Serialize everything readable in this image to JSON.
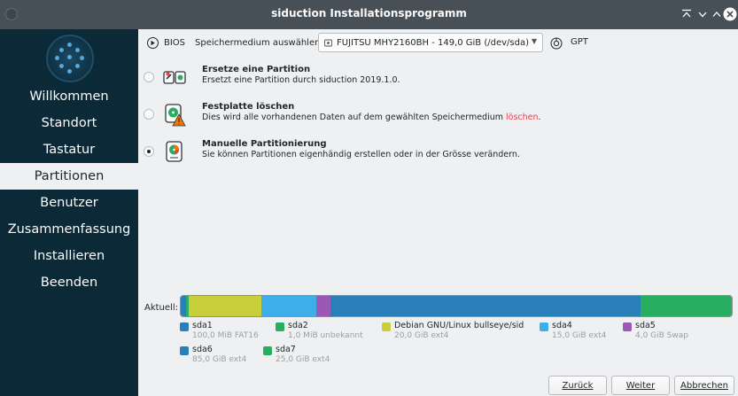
{
  "window": {
    "title": "siduction Installationsprogramm"
  },
  "sidebar": {
    "items": [
      {
        "label": "Willkommen",
        "active": false
      },
      {
        "label": "Standort",
        "active": false
      },
      {
        "label": "Tastatur",
        "active": false
      },
      {
        "label": "Partitionen",
        "active": true
      },
      {
        "label": "Benutzer",
        "active": false
      },
      {
        "label": "Zusammenfassung",
        "active": false
      },
      {
        "label": "Installieren",
        "active": false
      },
      {
        "label": "Beenden",
        "active": false
      }
    ]
  },
  "header": {
    "bios_label": "BIOS",
    "storage_label": "Speichermedium auswählen",
    "storage_selected": "FUJITSU MHY2160BH - 149,0 GiB (/dev/sda)",
    "table_type": "GPT"
  },
  "options": [
    {
      "title": "Ersetze eine Partition",
      "desc": "Ersetzt eine Partition durch siduction 2019.1.0.",
      "desc_red": "",
      "desc_end": "",
      "checked": false,
      "icon": "replace-partition-icon"
    },
    {
      "title": "Festplatte löschen",
      "desc": "Dies wird alle vorhandenen Daten auf dem gewählten Speichermedium ",
      "desc_red": "löschen",
      "desc_end": ".",
      "checked": false,
      "icon": "erase-disk-icon"
    },
    {
      "title": "Manuelle Partitionierung",
      "desc": "Sie können Partitionen eigenhändig erstellen oder in der Grösse verändern.",
      "desc_red": "",
      "desc_end": "",
      "checked": true,
      "icon": "manual-partition-icon"
    }
  ],
  "current": {
    "label": "Aktuell:",
    "partitions": [
      {
        "name": "sda1",
        "info": "100,0 MiB FAT16",
        "color": "#2980b9",
        "size_gib": 0.1
      },
      {
        "name": "sda2",
        "info": "1,0 MiB unbekannt",
        "color": "#27ae60",
        "size_gib": 0.001
      },
      {
        "name": "Debian GNU/Linux bullseye/sid",
        "info": "20,0 GiB ext4",
        "color": "#c9ce3b",
        "size_gib": 20.0
      },
      {
        "name": "sda4",
        "info": "15,0 GiB ext4",
        "color": "#3daee9",
        "size_gib": 15.0
      },
      {
        "name": "sda5",
        "info": "4,0 GiB Swap",
        "color": "#9b59b6",
        "size_gib": 4.0
      },
      {
        "name": "sda6",
        "info": "85,0 GiB ext4",
        "color": "#2980b9",
        "size_gib": 85.0
      },
      {
        "name": "sda7",
        "info": "25,0 GiB ext4",
        "color": "#27ae60",
        "size_gib": 25.0
      }
    ]
  },
  "buttons": {
    "back": "Zurück",
    "next": "Weiter",
    "cancel": "Abbrechen"
  }
}
